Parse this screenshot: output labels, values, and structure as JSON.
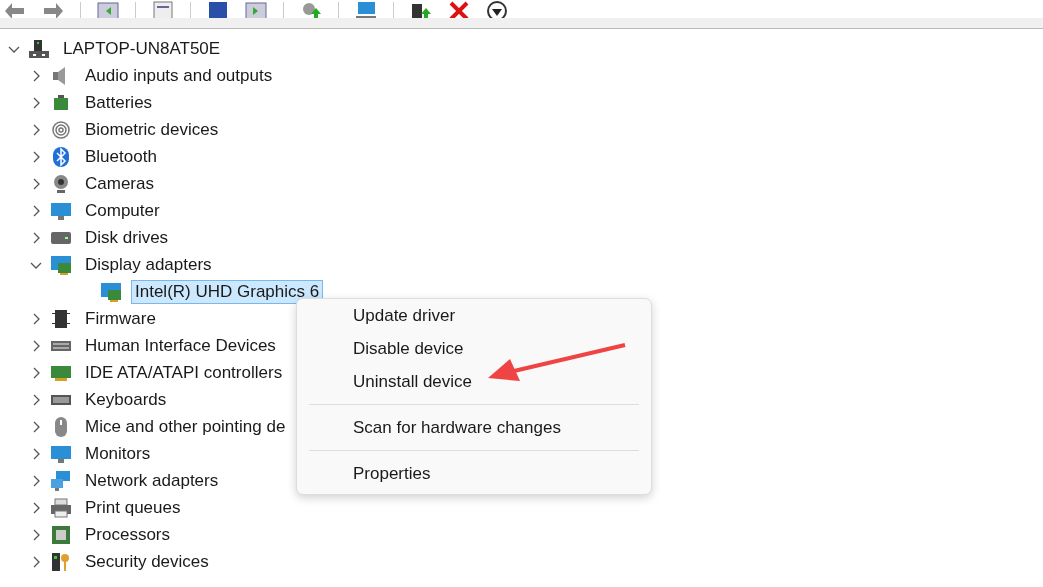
{
  "tree": {
    "label": "LAPTOP-UN8AT50E",
    "expanded": true,
    "selected": false,
    "children": [
      {
        "label": "Audio inputs and outputs",
        "expanded": false,
        "selected": false
      },
      {
        "label": "Batteries",
        "expanded": false,
        "selected": false
      },
      {
        "label": "Biometric devices",
        "expanded": false,
        "selected": false
      },
      {
        "label": "Bluetooth",
        "expanded": false,
        "selected": false
      },
      {
        "label": "Cameras",
        "expanded": false,
        "selected": false
      },
      {
        "label": "Computer",
        "expanded": false,
        "selected": false
      },
      {
        "label": "Disk drives",
        "expanded": false,
        "selected": false
      },
      {
        "label": "Display adapters",
        "expanded": true,
        "selected": false,
        "children": [
          {
            "label": "Intel(R) UHD Graphics 6",
            "selected": true
          }
        ]
      },
      {
        "label": "Firmware",
        "expanded": false,
        "selected": false
      },
      {
        "label": "Human Interface Devices",
        "expanded": false,
        "selected": false
      },
      {
        "label": "IDE ATA/ATAPI controllers",
        "expanded": false,
        "selected": false
      },
      {
        "label": "Keyboards",
        "expanded": false,
        "selected": false
      },
      {
        "label": "Mice and other pointing de",
        "expanded": false,
        "selected": false
      },
      {
        "label": "Monitors",
        "expanded": false,
        "selected": false
      },
      {
        "label": "Network adapters",
        "expanded": false,
        "selected": false
      },
      {
        "label": "Print queues",
        "expanded": false,
        "selected": false
      },
      {
        "label": "Processors",
        "expanded": false,
        "selected": false
      },
      {
        "label": "Security devices",
        "expanded": false,
        "selected": false
      }
    ]
  },
  "context_menu": {
    "groups": [
      [
        "Update driver",
        "Disable device",
        "Uninstall device"
      ],
      [
        "Scan for hardware changes"
      ],
      [
        "Properties"
      ]
    ]
  }
}
